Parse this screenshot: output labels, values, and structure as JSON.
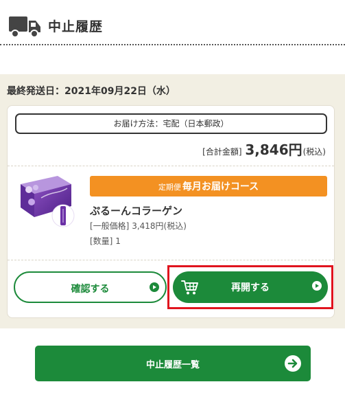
{
  "header": {
    "title": "中止履歴",
    "icon": "truck-icon"
  },
  "order": {
    "last_ship_date": "最終発送日：2021年09月22日（水）",
    "delivery_method": "お届け方法：宅配（日本郵政）",
    "total_label": "[合計金額]",
    "total_amount": "3,846円",
    "total_tax": "(税込)"
  },
  "item": {
    "course_prefix": "定期便",
    "course_name": "毎月お届けコース",
    "name": "ぷるーんコラーゲン",
    "price_label": "[一般価格]",
    "price_value": "3,418円(税込)",
    "qty_label": "[数量]",
    "qty_value": "1"
  },
  "actions": {
    "confirm_label": "確認する",
    "resume_label": "再開する",
    "history_list_label": "中止履歴一覧"
  },
  "colors": {
    "accent_green": "#1c8a3a",
    "course_orange": "#f39122",
    "highlight_red": "#e0141e",
    "section_bg": "#f2efe3"
  }
}
